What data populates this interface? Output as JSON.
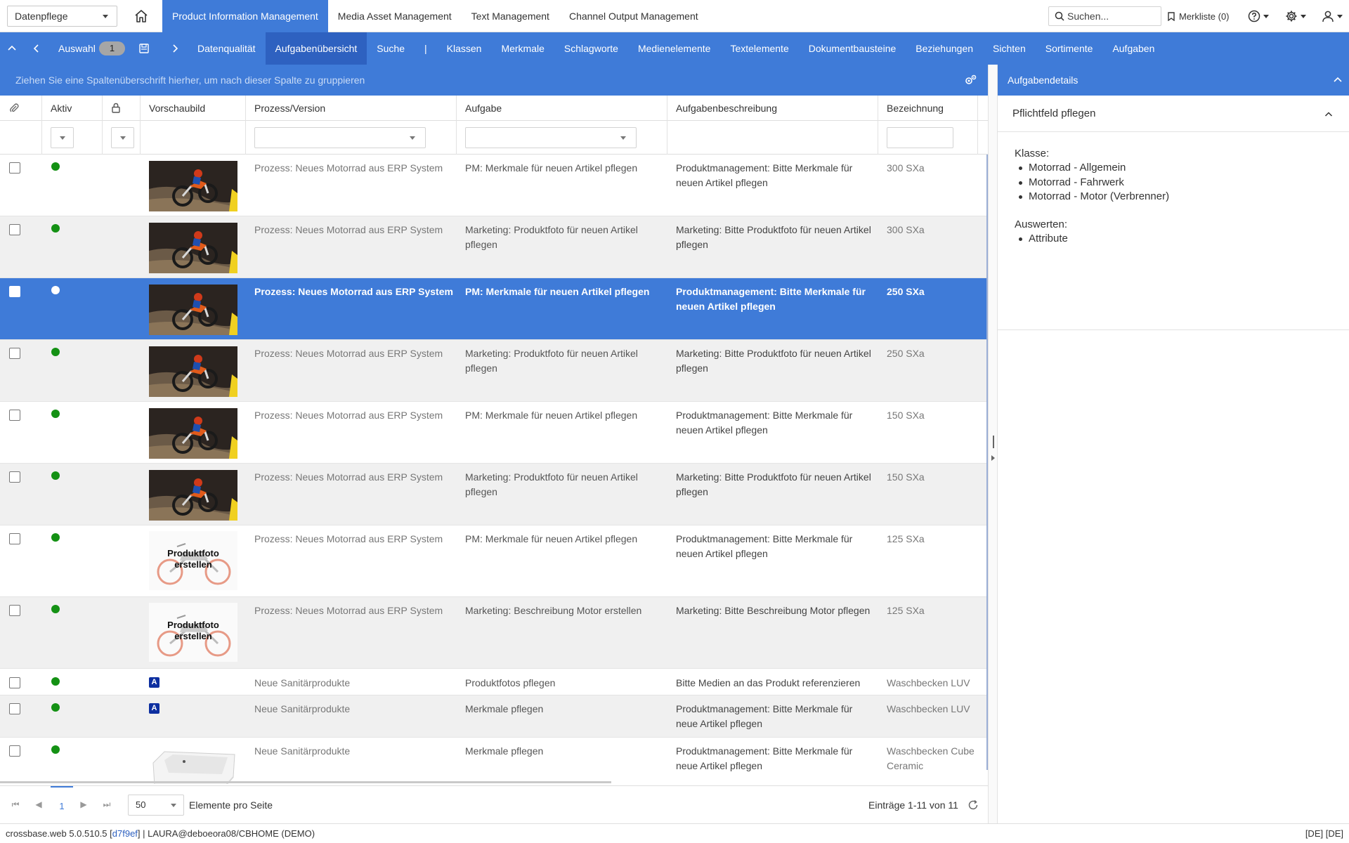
{
  "header": {
    "workspace": "Datenpflege",
    "tabs": [
      {
        "label": "Product Information Management",
        "active": true
      },
      {
        "label": "Media Asset Management",
        "active": false
      },
      {
        "label": "Text Management",
        "active": false
      },
      {
        "label": "Channel Output Management",
        "active": false
      }
    ],
    "search_placeholder": "Suchen...",
    "merkliste": "Merkliste (0)",
    "icons": [
      "home-icon",
      "search-icon",
      "bookmark-icon",
      "help-icon",
      "gear-icon",
      "user-icon"
    ]
  },
  "subnav": {
    "auswahl_label": "Auswahl",
    "auswahl_count": "1",
    "links": [
      {
        "label": "Datenqualität",
        "active": false
      },
      {
        "label": "Aufgabenübersicht",
        "active": true
      },
      {
        "label": "Suche",
        "active": false
      },
      {
        "label": "|",
        "separator": true
      },
      {
        "label": "Klassen",
        "active": false
      },
      {
        "label": "Merkmale",
        "active": false
      },
      {
        "label": "Schlagworte",
        "active": false
      },
      {
        "label": "Medienelemente",
        "active": false
      },
      {
        "label": "Textelemente",
        "active": false
      },
      {
        "label": "Dokumentbausteine",
        "active": false
      },
      {
        "label": "Beziehungen",
        "active": false
      },
      {
        "label": "Sichten",
        "active": false
      },
      {
        "label": "Sortimente",
        "active": false
      },
      {
        "label": "Aufgaben",
        "active": false
      }
    ]
  },
  "grid": {
    "group_hint": "Ziehen Sie eine Spaltenüberschrift hierher, um nach dieser Spalte zu gruppieren",
    "columns": {
      "aktiv": "Aktiv",
      "vorschaubild": "Vorschaubild",
      "prozess": "Prozess/Version",
      "aufgabe": "Aufgabe",
      "beschreibung": "Aufgabenbeschreibung",
      "bezeichnung": "Bezeichnung"
    },
    "rows": [
      {
        "thumb": "motocross",
        "prozess": "Prozess: Neues Motorrad aus ERP System",
        "aufgabe": "PM: Merkmale für neuen Artikel pflegen",
        "beschreibung": "Produktmanagement: Bitte Merkmale für neuen Artikel pflegen",
        "bezeichnung": "300 SXa",
        "selected": false
      },
      {
        "thumb": "motocross",
        "prozess": "Prozess: Neues Motorrad aus ERP System",
        "aufgabe": "Marketing: Produktfoto für neuen Artikel pflegen",
        "beschreibung": "Marketing: Bitte Produktfoto für neuen Artikel pflegen",
        "bezeichnung": "300 SXa",
        "selected": false
      },
      {
        "thumb": "motocross",
        "prozess": "Prozess: Neues Motorrad aus ERP System",
        "aufgabe": "PM: Merkmale für neuen Artikel pflegen",
        "beschreibung": "Produktmanagement: Bitte Merkmale für neuen Artikel pflegen",
        "bezeichnung": "250 SXa",
        "selected": true
      },
      {
        "thumb": "motocross",
        "prozess": "Prozess: Neues Motorrad aus ERP System",
        "aufgabe": "Marketing: Produktfoto für neuen Artikel pflegen",
        "beschreibung": "Marketing: Bitte Produktfoto für neuen Artikel pflegen",
        "bezeichnung": "250 SXa",
        "selected": false
      },
      {
        "thumb": "motocross",
        "prozess": "Prozess: Neues Motorrad aus ERP System",
        "aufgabe": "PM: Merkmale für neuen Artikel pflegen",
        "beschreibung": "Produktmanagement: Bitte Merkmale für neuen Artikel pflegen",
        "bezeichnung": "150 SXa",
        "selected": false
      },
      {
        "thumb": "motocross",
        "prozess": "Prozess: Neues Motorrad aus ERP System",
        "aufgabe": "Marketing: Produktfoto für neuen Artikel pflegen",
        "beschreibung": "Marketing: Bitte Produktfoto für neuen Artikel pflegen",
        "bezeichnung": "150 SXa",
        "selected": false
      },
      {
        "thumb": "placeholder",
        "thumb_text": [
          "Produktfoto",
          "erstellen"
        ],
        "prozess": "Prozess: Neues Motorrad aus ERP System",
        "aufgabe": "PM: Merkmale für neuen Artikel pflegen",
        "beschreibung": "Produktmanagement: Bitte Merkmale für neuen Artikel pflegen",
        "bezeichnung": "125 SXa",
        "selected": false
      },
      {
        "thumb": "placeholder",
        "thumb_text": [
          "Produktfoto",
          "erstellen"
        ],
        "prozess": "Prozess: Neues Motorrad aus ERP System",
        "aufgabe": "Marketing: Beschreibung Motor erstellen",
        "beschreibung": "Marketing: Bitte Beschreibung Motor pflegen",
        "bezeichnung": "125 SXa",
        "selected": false
      },
      {
        "thumb": "badge",
        "badge_text": "A",
        "prozess": "Neue Sanitärprodukte",
        "aufgabe": "Produktfotos pflegen",
        "beschreibung": "Bitte Medien an das Produkt referenzieren",
        "bezeichnung": "Waschbecken LUV",
        "selected": false
      },
      {
        "thumb": "badge",
        "badge_text": "A",
        "prozess": "Neue Sanitärprodukte",
        "aufgabe": "Merkmale pflegen",
        "beschreibung": "Produktmanagement: Bitte Merkmale für neue Artikel pflegen",
        "bezeichnung": "Waschbecken LUV",
        "selected": false
      },
      {
        "thumb": "sink",
        "prozess": "Neue Sanitärprodukte",
        "aufgabe": "Merkmale pflegen",
        "beschreibung": "Produktmanagement: Bitte Merkmale für neue Artikel pflegen",
        "bezeichnung": "Waschbecken Cube Ceramic",
        "selected": false
      }
    ]
  },
  "pager": {
    "current_page": "1",
    "page_size": "50",
    "page_size_label": "Elemente pro Seite",
    "info": "Einträge 1-11 von 11"
  },
  "details": {
    "header": "Aufgabendetails",
    "section_title": "Pflichtfeld pflegen",
    "klasse_label": "Klasse:",
    "klassen": [
      "Motorrad - Allgemein",
      "Motorrad - Fahrwerk",
      "Motorrad - Motor (Verbrenner)"
    ],
    "auswerten_label": "Auswerten:",
    "auswerten": [
      "Attribute"
    ]
  },
  "statusbar": {
    "prefix": "crossbase.web 5.0.510.5 [",
    "hash": "d7f9ef",
    "suffix": "] | LAURA@deboeora08/CBHOME (DEMO)",
    "lang": "[DE] [DE]"
  },
  "colors": {
    "accent": "#3f7bd8",
    "accent_dark": "#2e61c0",
    "status_active": "#149114"
  }
}
